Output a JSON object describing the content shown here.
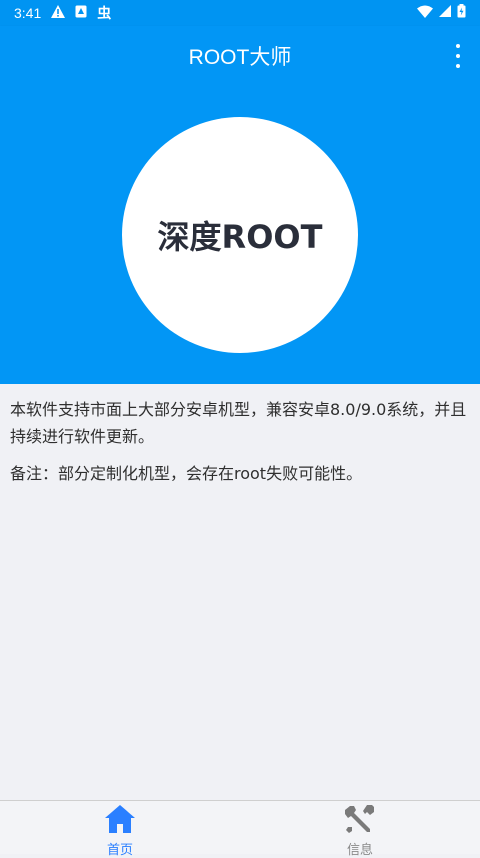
{
  "status_bar": {
    "time": "3:41",
    "icons_left": [
      "warning-icon",
      "sim-app-icon",
      "worm-app-icon"
    ],
    "icons_right": [
      "wifi-icon",
      "signal-icon",
      "battery-icon"
    ],
    "glyph_worm": "虫"
  },
  "app_bar": {
    "title": "ROOT大师",
    "menu_icon": "more-vert-icon"
  },
  "hero": {
    "button_label": "深度ROOT",
    "background_color": "#0296f5"
  },
  "content": {
    "description": "本软件支持市面上大部分安卓机型，兼容安卓8.0/9.0系统，并且持续进行软件更新。",
    "note": "备注：部分定制化机型，会存在root失败可能性。"
  },
  "bottom_nav": {
    "items": [
      {
        "label": "首页",
        "icon": "home-icon",
        "selected": true,
        "color": "#2a7fff"
      },
      {
        "label": "信息",
        "icon": "tools-icon",
        "selected": false,
        "color": "#8a8a8a"
      }
    ]
  }
}
